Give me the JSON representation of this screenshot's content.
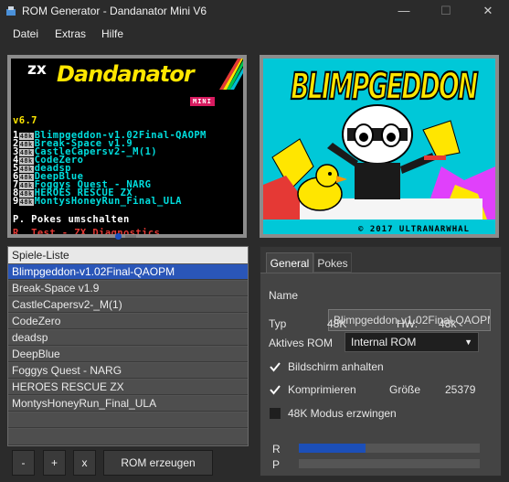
{
  "window": {
    "title": "ROM Generator - Dandanator Mini V6",
    "minimize": "—",
    "maximize": "☐",
    "close": "✕"
  },
  "menu": [
    "Datei",
    "Extras",
    "Hilfe"
  ],
  "zx_screen": {
    "logo_zx": "zx",
    "logo_name": "Dandanator",
    "logo_badge": "MINI",
    "version": "v6.7",
    "games": [
      {
        "num": "1",
        "k": "48k",
        "name": "Blimpgeddon-v1.02Final-QAOPM"
      },
      {
        "num": "2",
        "k": "48k",
        "name": "Break-Space v1.9"
      },
      {
        "num": "3",
        "k": "48k",
        "name": "CastleCapersv2-_M(1)"
      },
      {
        "num": "4",
        "k": "48k",
        "name": "CodeZero"
      },
      {
        "num": "5",
        "k": "48k",
        "name": "deadsp"
      },
      {
        "num": "6",
        "k": "48k",
        "name": "DeepBlue"
      },
      {
        "num": "7",
        "k": "48k",
        "name": "Foggys Quest - NARG"
      },
      {
        "num": "8",
        "k": "48k",
        "name": "HEROES RESCUE ZX"
      },
      {
        "num": "9",
        "k": "48k",
        "name": "MontysHoneyRun_Final_ULA"
      }
    ],
    "pokes_line": "P. Pokes umschalten",
    "test_line": "R. Test - ZX Diagnostics"
  },
  "preview": {
    "game_logo": "BLIMPGEDDON",
    "copyright": "© 2017 ULTRANARWHAL"
  },
  "list": {
    "header": "Spiele-Liste",
    "items": [
      "Blimpgeddon-v1.02Final-QAOPM",
      "Break-Space v1.9",
      "CastleCapersv2-_M(1)",
      "CodeZero",
      "deadsp",
      "DeepBlue",
      "Foggys Quest - NARG",
      "HEROES RESCUE ZX",
      "MontysHoneyRun_Final_ULA"
    ],
    "selected_index": 0
  },
  "buttons": {
    "remove": "-",
    "add": "+",
    "clear": "x",
    "generate": "ROM erzeugen"
  },
  "tabs": [
    "General",
    "Pokes"
  ],
  "details": {
    "name_label": "Name",
    "name_value": "Blimpgeddon-v1.02Final-QAOPM",
    "type_label": "Typ",
    "type_value": "48K",
    "hw_label": "HW:",
    "hw_value": "48k",
    "rom_label": "Aktives ROM",
    "rom_value": "Internal ROM",
    "screen_save_label": "Bildschirm anhalten",
    "screen_save_checked": true,
    "compress_label": "Komprimieren",
    "compress_checked": true,
    "size_label": "Größe",
    "size_value": "25379",
    "force48_label": "48K Modus erzwingen",
    "force48_checked": false
  },
  "progress": {
    "r_label": "R",
    "r_value": 0.37,
    "p_label": "P",
    "p_value": 0
  },
  "colors": {
    "selection": "#2a56b8",
    "progress_fill": "#1c4fb8",
    "zx_cyan": "#00dede"
  }
}
